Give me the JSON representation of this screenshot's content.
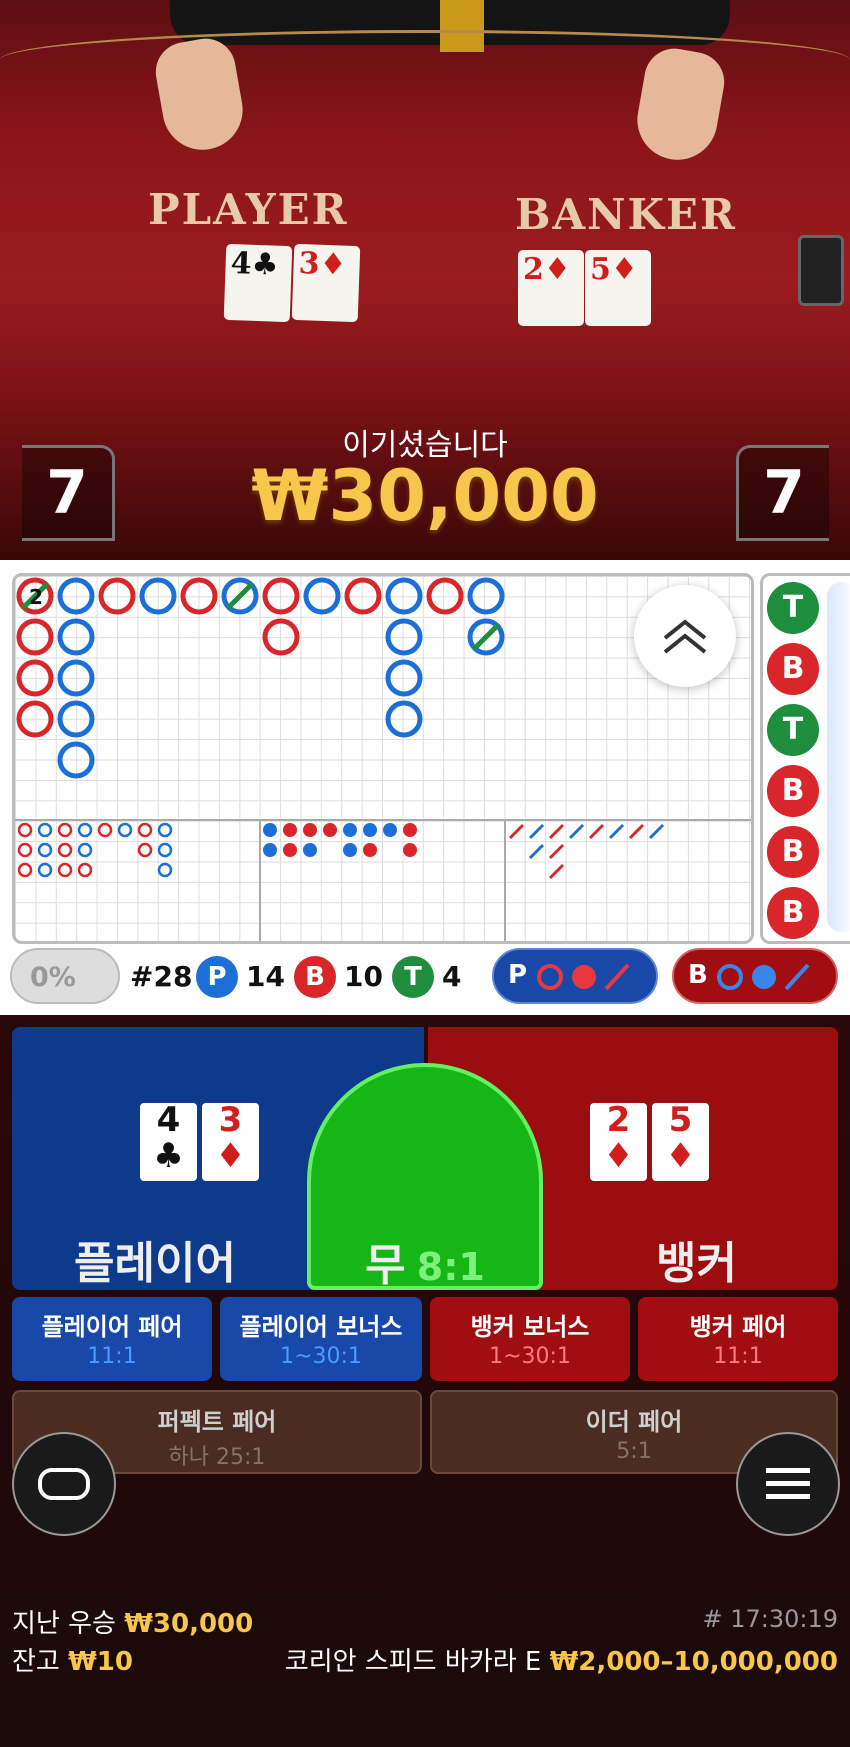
{
  "table": {
    "player_label": "PLAYER",
    "banker_label": "BANKER",
    "player_cards": [
      {
        "rank": "4",
        "suit": "♣",
        "color": "#111"
      },
      {
        "rank": "3",
        "suit": "♦",
        "color": "#d21d1d"
      }
    ],
    "banker_cards": [
      {
        "rank": "2",
        "suit": "♦",
        "color": "#d21d1d"
      },
      {
        "rank": "5",
        "suit": "♦",
        "color": "#d21d1d"
      }
    ],
    "player_score": "7",
    "banker_score": "7",
    "win_message": "이기셨습니다",
    "win_amount": "₩30,000"
  },
  "roadmap": {
    "first_cell_label": "2",
    "side_road": [
      "T",
      "B",
      "T",
      "B",
      "B",
      "B"
    ],
    "expand_icon": "chevron-double-up-icon"
  },
  "stats": {
    "percent": "0%",
    "round": "#28",
    "player_letter": "P",
    "player_count": "14",
    "banker_letter": "B",
    "banker_count": "10",
    "tie_letter": "T",
    "tie_count": "4",
    "player_predict_letter": "P",
    "banker_predict_letter": "B"
  },
  "bets": {
    "player": "플레이어",
    "tie": "무",
    "tie_odds": "8:1",
    "banker": "뱅커",
    "player_pair": "플레이어 페어",
    "player_pair_odds": "11:1",
    "player_bonus": "플레이어 보너스",
    "player_bonus_odds": "1~30:1",
    "banker_bonus": "뱅커 보너스",
    "banker_bonus_odds": "1~30:1",
    "banker_pair": "뱅커 페어",
    "banker_pair_odds": "11:1",
    "perfect_pair": "퍼펙트 페어",
    "perfect_pair_odds": "하나 25:1",
    "either_pair": "이더 페어",
    "either_pair_odds": "5:1"
  },
  "footer": {
    "last_win_label": "지난 우승",
    "last_win_amount": "₩30,000",
    "balance_label": "잔고",
    "balance_amount": "₩10",
    "round_time": "# 17:30:19",
    "table_name": "코리안 스피드 바카라 E",
    "bet_limits": "₩2,000–10,000,000"
  },
  "colors": {
    "player": "#1c6fd6",
    "banker": "#d8262a",
    "tie": "#1e8e3e",
    "gold": "#f7c64a"
  }
}
